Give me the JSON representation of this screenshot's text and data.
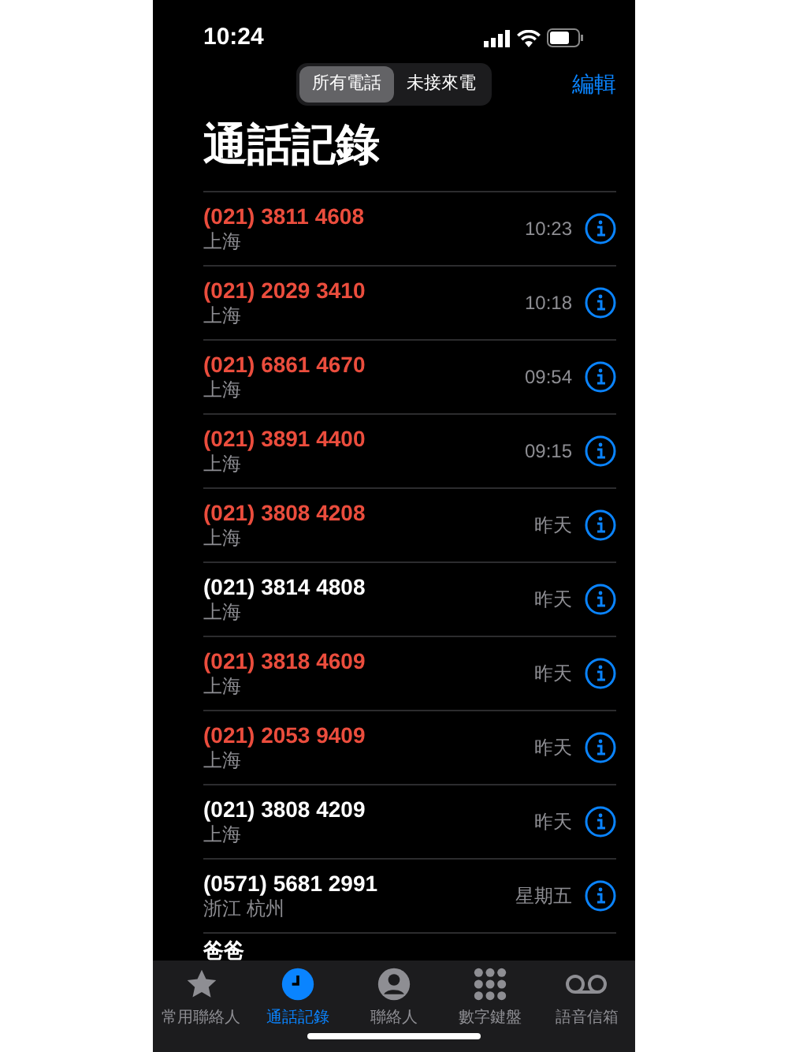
{
  "status_bar": {
    "time": "10:24"
  },
  "segments": [
    {
      "label": "所有電話",
      "selected": true
    },
    {
      "label": "未接來電",
      "selected": false
    }
  ],
  "edit_label": "編輯",
  "title": "通話記錄",
  "calls": [
    {
      "number": "(021) 3811 4608",
      "location": "上海",
      "time": "10:23",
      "missed": true
    },
    {
      "number": "(021) 2029 3410",
      "location": "上海",
      "time": "10:18",
      "missed": true
    },
    {
      "number": "(021) 6861 4670",
      "location": "上海",
      "time": "09:54",
      "missed": true
    },
    {
      "number": "(021) 3891 4400",
      "location": "上海",
      "time": "09:15",
      "missed": true
    },
    {
      "number": "(021) 3808 4208",
      "location": "上海",
      "time": "昨天",
      "missed": true
    },
    {
      "number": "(021) 3814 4808",
      "location": "上海",
      "time": "昨天",
      "missed": false
    },
    {
      "number": "(021) 3818 4609",
      "location": "上海",
      "time": "昨天",
      "missed": true
    },
    {
      "number": "(021) 2053 9409",
      "location": "上海",
      "time": "昨天",
      "missed": true
    },
    {
      "number": "(021) 3808 4209",
      "location": "上海",
      "time": "昨天",
      "missed": false
    },
    {
      "number": "(0571) 5681 2991",
      "location": "浙江 杭州",
      "time": "星期五",
      "missed": false
    }
  ],
  "partial_call": {
    "number": "爸爸",
    "missed": false
  },
  "tab_bar": [
    {
      "label": "常用聯絡人",
      "kind": "star",
      "selected": false
    },
    {
      "label": "通話記錄",
      "kind": "clock",
      "selected": true
    },
    {
      "label": "聯絡人",
      "kind": "person",
      "selected": false
    },
    {
      "label": "數字鍵盤",
      "kind": "keypad",
      "selected": false
    },
    {
      "label": "語音信箱",
      "kind": "voicemail",
      "selected": false
    }
  ]
}
